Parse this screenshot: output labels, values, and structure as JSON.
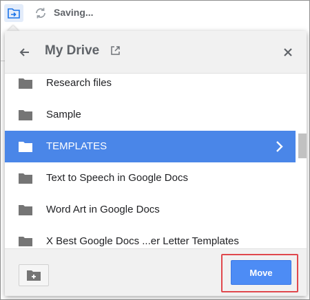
{
  "toolbar": {
    "move_icon": "folder-move-icon",
    "sync_icon": "sync-icon",
    "status_text": "Saving..."
  },
  "dialog": {
    "title": "My Drive",
    "back_icon": "arrow-left-icon",
    "open_icon": "open-in-new-icon",
    "close_icon": "close-icon",
    "folders": [
      {
        "label": "Research files",
        "selected": false
      },
      {
        "label": "Sample",
        "selected": false
      },
      {
        "label": "TEMPLATES",
        "selected": true
      },
      {
        "label": "Text to Speech in Google Docs",
        "selected": false
      },
      {
        "label": "Word Art in Google Docs",
        "selected": false
      },
      {
        "label": "X Best Google Docs ...er Letter Templates",
        "selected": false
      }
    ],
    "new_folder_icon": "new-folder-icon",
    "move_label": "Move"
  },
  "colors": {
    "selected_row": "#4a86e8",
    "move_button": "#4d8cf5",
    "highlight_box": "#e0474c"
  }
}
